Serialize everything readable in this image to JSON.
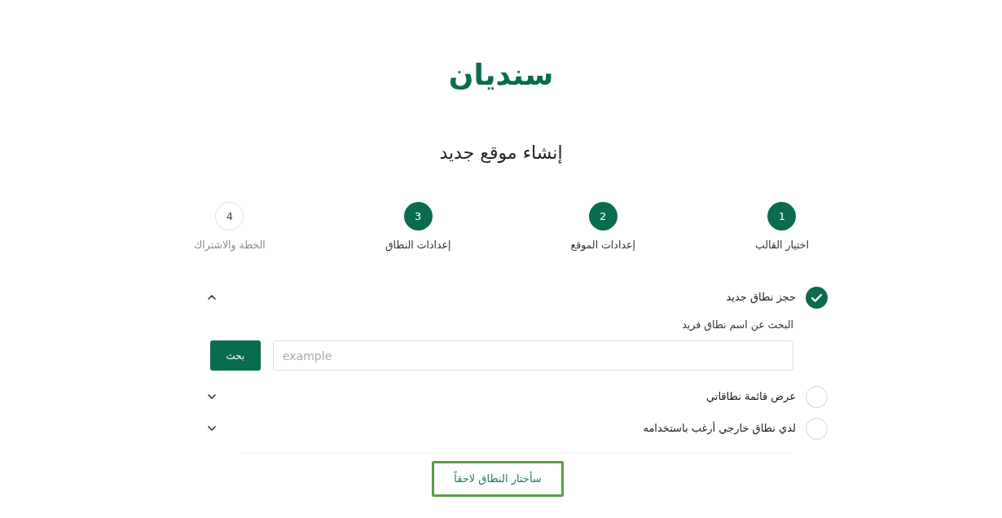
{
  "logo": {
    "text": "سنديان"
  },
  "title": "إنشاء موقع جديد",
  "steps": [
    {
      "number": "1",
      "label": "اختيار القالب",
      "active": true
    },
    {
      "number": "2",
      "label": "إعدادات الموقع",
      "active": true
    },
    {
      "number": "3",
      "label": "إعدادات النطاق",
      "active": true
    },
    {
      "number": "4",
      "label": "الخطة والاشتراك",
      "active": false
    }
  ],
  "domain_options": [
    {
      "label": "حجز نطاق جديد",
      "selected": true,
      "expanded": true,
      "search": {
        "label": "البحث عن اسم نطاق فريد",
        "placeholder": "example",
        "button": "بحث"
      }
    },
    {
      "label": "عرض قائمة نطاقاتي",
      "selected": false,
      "expanded": false
    },
    {
      "label": "لدي نطاق خارجي أرغب باستخدامه",
      "selected": false,
      "expanded": false
    }
  ],
  "skip_button": {
    "label": "سأختار النطاق لاحقاً",
    "focused": true
  }
}
